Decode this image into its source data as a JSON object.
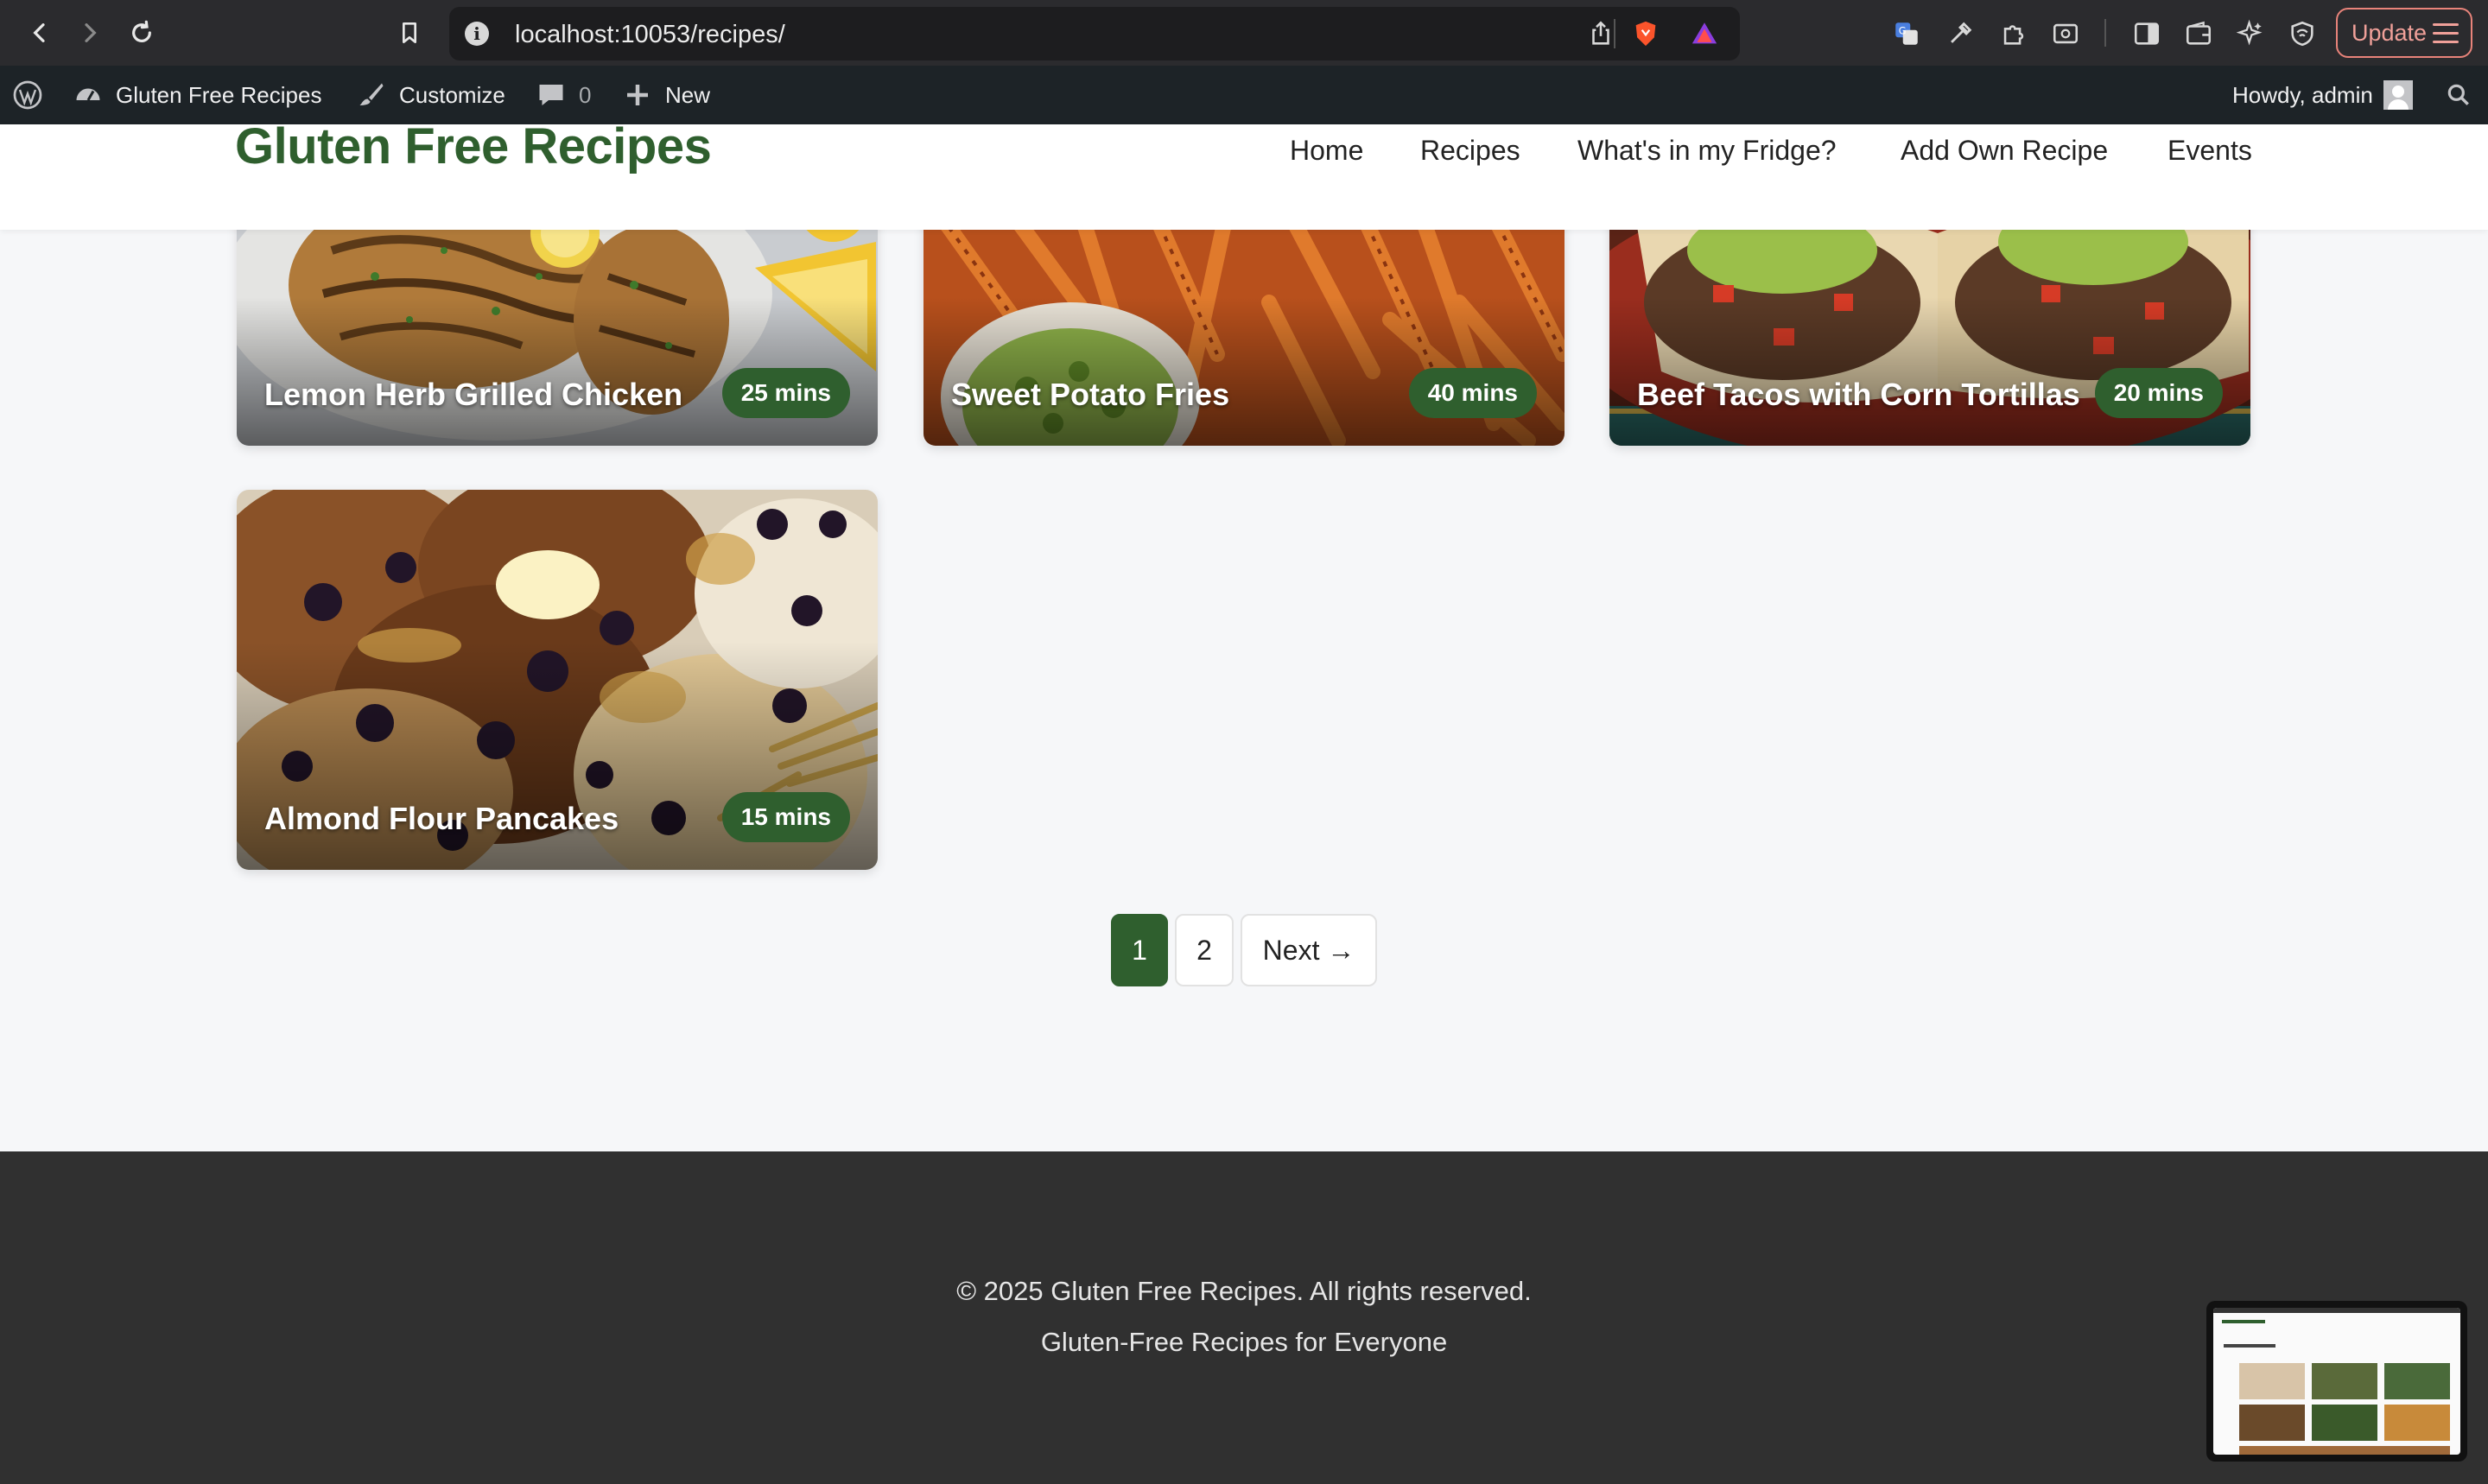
{
  "browser": {
    "url": "localhost:10053/recipes/",
    "update_label": "Update"
  },
  "admin_bar": {
    "site_name": "Gluten Free Recipes",
    "customize": "Customize",
    "comments_count": "0",
    "new": "New",
    "howdy": "Howdy, admin"
  },
  "site": {
    "title": "Gluten Free Recipes",
    "nav": [
      "Home",
      "Recipes",
      "What's in my Fridge?",
      "Add Own Recipe",
      "Events"
    ]
  },
  "recipes": [
    {
      "title": "Lemon Herb Grilled Chicken",
      "time": "25 mins"
    },
    {
      "title": "Sweet Potato Fries",
      "time": "40 mins"
    },
    {
      "title": "Beef Tacos with Corn Tortillas",
      "time": "20 mins"
    },
    {
      "title": "Almond Flour Pancakes",
      "time": "15 mins"
    }
  ],
  "pagination": {
    "pages": [
      "1",
      "2"
    ],
    "current": "1",
    "next": "Next →"
  },
  "footer": {
    "copyright": "© 2025 Gluten Free Recipes. All rights reserved.",
    "tagline": "Gluten-Free Recipes for Everyone"
  },
  "colors": {
    "brand_green": "#2f5f2e",
    "admin_bar": "#1d2327",
    "footer_bg": "#303030"
  }
}
